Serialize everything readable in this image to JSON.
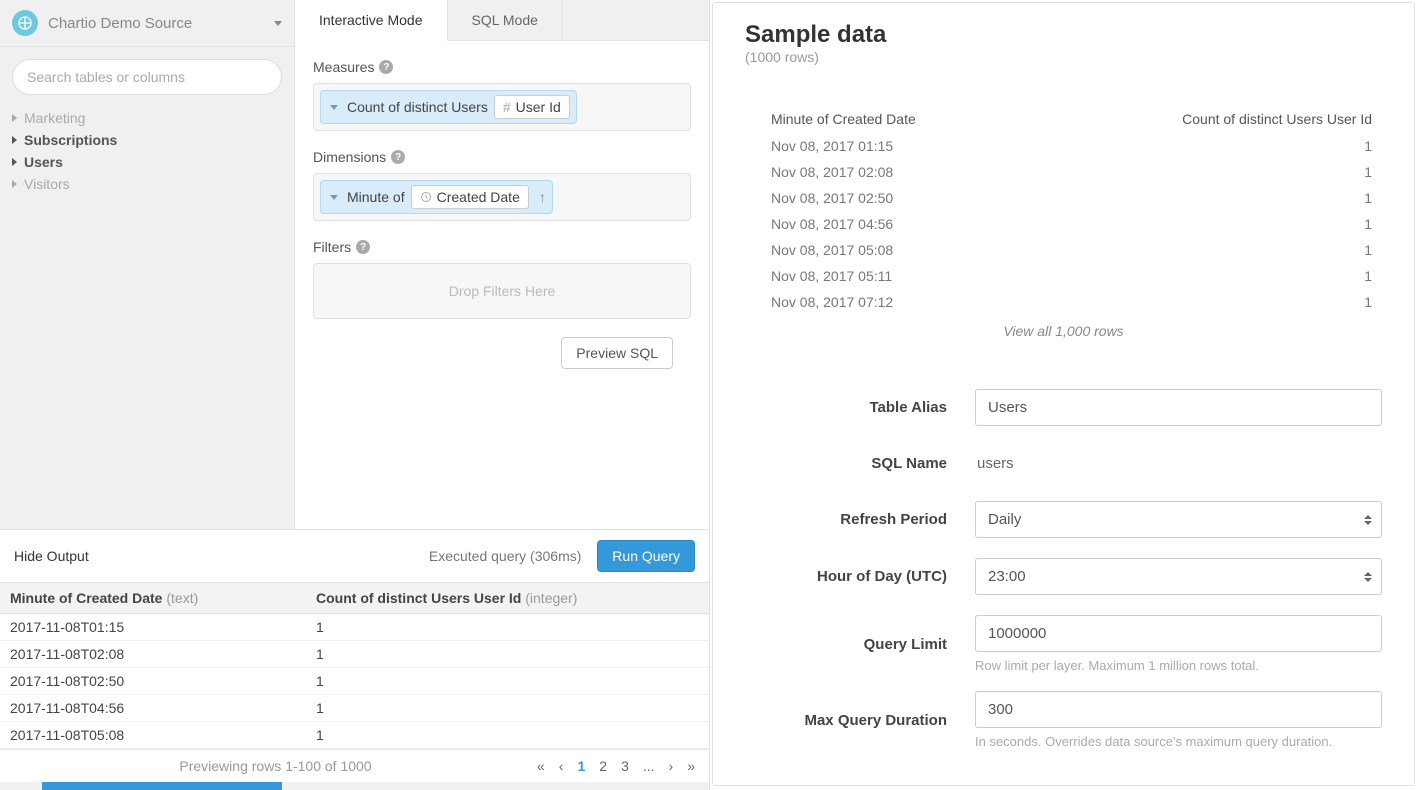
{
  "source": {
    "name": "Chartio Demo Source"
  },
  "search": {
    "placeholder": "Search tables or columns"
  },
  "tree": [
    {
      "label": "Marketing",
      "active": false
    },
    {
      "label": "Subscriptions",
      "active": true
    },
    {
      "label": "Users",
      "active": true
    },
    {
      "label": "Visitors",
      "active": false
    }
  ],
  "tabs": {
    "interactive": "Interactive Mode",
    "sql": "SQL Mode"
  },
  "builder": {
    "measures_label": "Measures",
    "dimensions_label": "Dimensions",
    "filters_label": "Filters",
    "filters_placeholder": "Drop Filters Here",
    "measure": {
      "agg": "Count of distinct Users",
      "field": "User Id"
    },
    "dimension": {
      "bucket": "Minute of",
      "field": "Created Date"
    },
    "preview_sql": "Preview SQL"
  },
  "output": {
    "hide_label": "Hide Output",
    "executed": "Executed query (306ms)",
    "run": "Run Query",
    "col1_name": "Minute of Created Date",
    "col1_type": "(text)",
    "col2_name": "Count of distinct Users User Id",
    "col2_type": "(integer)",
    "rows": [
      {
        "c1": "2017-11-08T01:15",
        "c2": "1"
      },
      {
        "c1": "2017-11-08T02:08",
        "c2": "1"
      },
      {
        "c1": "2017-11-08T02:50",
        "c2": "1"
      },
      {
        "c1": "2017-11-08T04:56",
        "c2": "1"
      },
      {
        "c1": "2017-11-08T05:08",
        "c2": "1"
      }
    ],
    "preview_text": "Previewing rows 1-100 of 1000",
    "pages": {
      "first": "«",
      "prev": "‹",
      "p1": "1",
      "p2": "2",
      "p3": "3",
      "dots": "...",
      "next": "›",
      "last": "»"
    }
  },
  "right": {
    "title": "Sample data",
    "subtitle": "(1000 rows)",
    "head1": "Minute of Created Date",
    "head2": "Count of distinct Users User Id",
    "rows": [
      {
        "c1": "Nov 08, 2017 01:15",
        "c2": "1"
      },
      {
        "c1": "Nov 08, 2017 02:08",
        "c2": "1"
      },
      {
        "c1": "Nov 08, 2017 02:50",
        "c2": "1"
      },
      {
        "c1": "Nov 08, 2017 04:56",
        "c2": "1"
      },
      {
        "c1": "Nov 08, 2017 05:08",
        "c2": "1"
      },
      {
        "c1": "Nov 08, 2017 05:11",
        "c2": "1"
      },
      {
        "c1": "Nov 08, 2017 07:12",
        "c2": "1"
      }
    ],
    "view_all": "View all 1,000 rows",
    "form": {
      "table_alias_label": "Table Alias",
      "table_alias_value": "Users",
      "sql_name_label": "SQL Name",
      "sql_name_value": "users",
      "refresh_label": "Refresh Period",
      "refresh_value": "Daily",
      "hour_label": "Hour of Day (UTC)",
      "hour_value": "23:00",
      "query_limit_label": "Query Limit",
      "query_limit_value": "1000000",
      "query_limit_hint": "Row limit per layer. Maximum 1 million rows total.",
      "max_duration_label": "Max Query Duration",
      "max_duration_value": "300",
      "max_duration_hint": "In seconds. Overrides data source's maximum query duration."
    }
  }
}
